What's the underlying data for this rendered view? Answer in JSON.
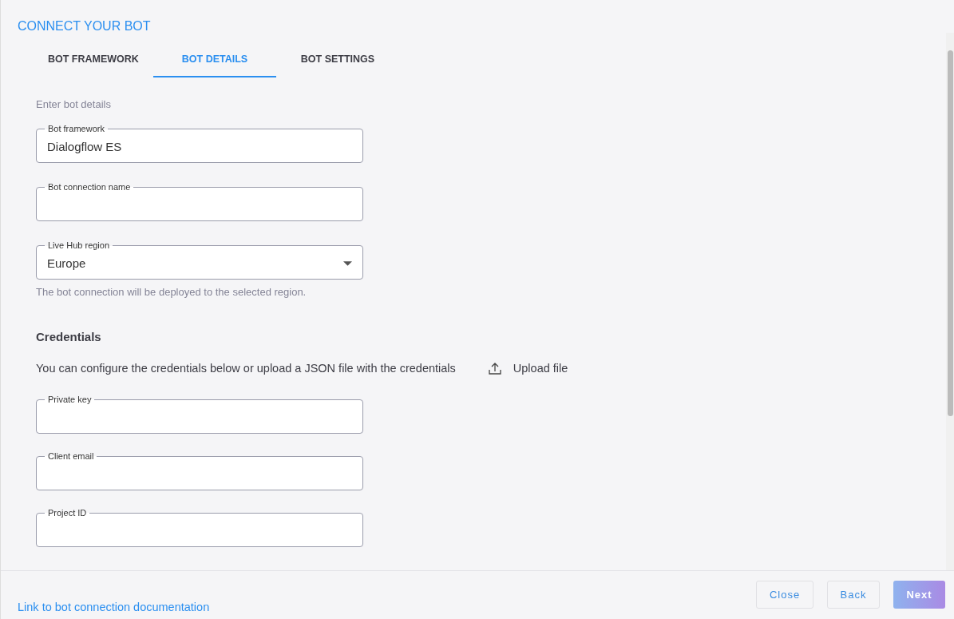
{
  "title": "CONNECT YOUR BOT",
  "tabs": [
    {
      "label": "BOT FRAMEWORK",
      "selected": false
    },
    {
      "label": "BOT DETAILS",
      "selected": true
    },
    {
      "label": "BOT SETTINGS",
      "selected": false
    }
  ],
  "intro": "Enter bot details",
  "fields_top": [
    {
      "kind": "text",
      "label": "Bot framework",
      "value": "Dialogflow ES"
    },
    {
      "kind": "text",
      "label": "Bot connection name"
    },
    {
      "kind": "select",
      "label": "Live Hub region",
      "value": "Europe",
      "help": "The bot connection will be deployed to the selected region."
    }
  ],
  "credentials": {
    "heading": "Credentials",
    "description": "You can configure the credentials below or upload a JSON file with the credentials",
    "upload_label": "Upload file",
    "fields": [
      {
        "kind": "text",
        "label": "Private key"
      },
      {
        "kind": "text",
        "label": "Client email"
      },
      {
        "kind": "text",
        "label": "Project ID"
      }
    ]
  },
  "footer": {
    "link": "Link to bot connection documentation",
    "buttons": [
      {
        "label": "Close",
        "disabled": false
      },
      {
        "label": "Back",
        "disabled": false
      },
      {
        "label": "Next",
        "disabled": true
      }
    ]
  }
}
